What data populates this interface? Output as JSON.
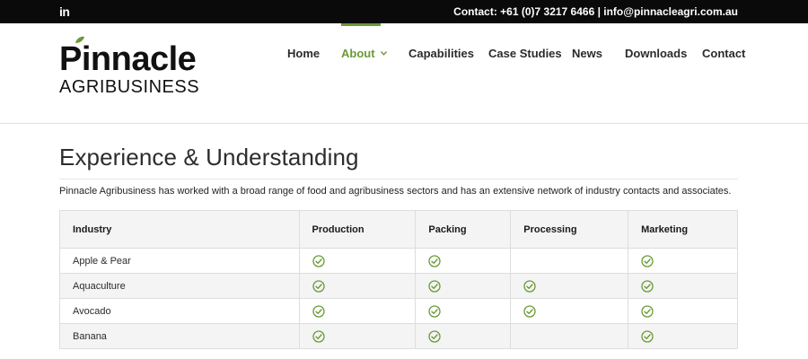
{
  "topbar": {
    "social_icon": "linkedin-icon",
    "social_label": "in",
    "contact": "Contact: +61 (0)7 3217 6466 | info@pinnacleagri.com.au"
  },
  "logo": {
    "main": "Pinnacle",
    "sub": "AGRIBUSINESS",
    "leaf_color": "#6a9a34"
  },
  "nav": {
    "items": [
      {
        "label": "Home",
        "active": false
      },
      {
        "label": "About",
        "active": true,
        "has_dropdown": true
      },
      {
        "label": "Capabilities",
        "active": false
      },
      {
        "label": "Case Studies",
        "active": false
      },
      {
        "label": "News",
        "active": false
      },
      {
        "label": "Downloads",
        "active": false
      },
      {
        "label": "Contact",
        "active": false
      }
    ]
  },
  "colors": {
    "accent": "#6a9a34",
    "topbar": "#0a0a0a"
  },
  "main": {
    "title": "Experience & Understanding",
    "intro": "Pinnacle Agribusiness has worked with a broad range of food and agribusiness sectors and has an extensive network of industry contacts and associates."
  },
  "table": {
    "headers": [
      "Industry",
      "Production",
      "Packing",
      "Processing",
      "Marketing"
    ],
    "check_icon": "check-circle-icon",
    "rows": [
      {
        "industry": "Apple & Pear",
        "checks": [
          true,
          true,
          false,
          true
        ]
      },
      {
        "industry": "Aquaculture",
        "checks": [
          true,
          true,
          true,
          true
        ]
      },
      {
        "industry": "Avocado",
        "checks": [
          true,
          true,
          true,
          true
        ]
      },
      {
        "industry": "Banana",
        "checks": [
          true,
          true,
          false,
          true
        ]
      }
    ]
  }
}
